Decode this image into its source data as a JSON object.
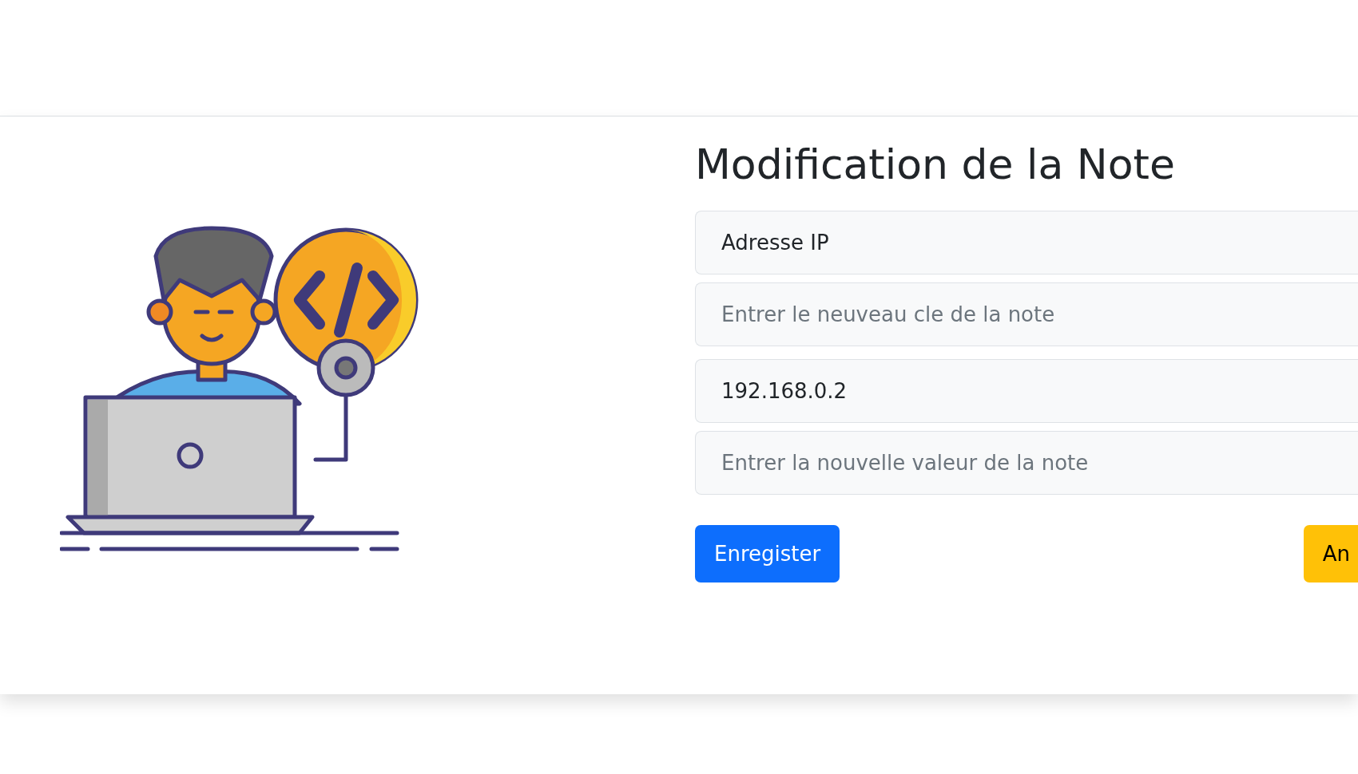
{
  "form": {
    "title": "Modification de la Note",
    "fields": [
      {
        "value": "Adresse IP"
      },
      {
        "placeholder": "Entrer le neuveau cle de la note"
      },
      {
        "value": "192.168.0.2"
      },
      {
        "placeholder": "Entrer la nouvelle valeur de la note"
      }
    ],
    "buttons": [
      {
        "label": "Enregister",
        "kind": "primary"
      },
      {
        "label": "An",
        "kind": "warning"
      }
    ]
  }
}
